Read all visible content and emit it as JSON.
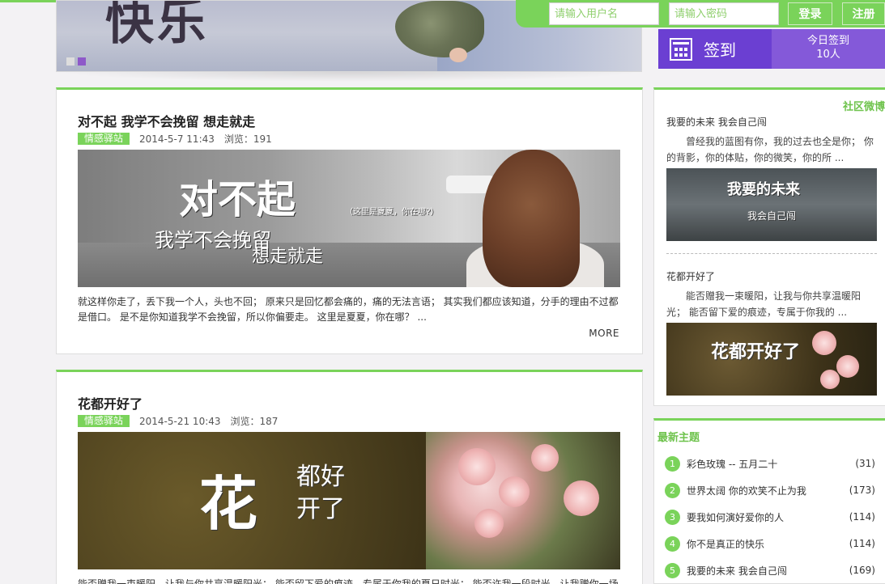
{
  "login": {
    "username_placeholder": "请输入用户名",
    "password_placeholder": "请输入密码",
    "login_label": "登录",
    "register_label": "注册"
  },
  "checkin": {
    "label": "签到",
    "today_label": "今日签到",
    "today_count": "10人"
  },
  "posts": [
    {
      "title": "对不起 我学不会挽留 想走就走",
      "tag": "情感驿站",
      "date": "2014-5-7 11:43",
      "views": "浏览：191",
      "excerpt": "就这样你走了，丢下我一个人，头也不回； 原来只是回忆都会痛的，痛的无法言语； 其实我们都应该知道，分手的理由不过都是借口。 是不是你知道我学不会挽留，所以你偏要走。 这里是夏夏，你在哪？ ...",
      "more": "MORE",
      "img_text_main": "对不起",
      "img_text_sub1": "我学不会挽留",
      "img_text_sub2": "想走就走",
      "img_text_note": "（这里是夏夏，你在哪?）"
    },
    {
      "title": "花都开好了",
      "tag": "情感驿站",
      "date": "2014-5-21 10:43",
      "views": "浏览：187",
      "excerpt": "能否赠我一束暖阳，让我与你共享温暖阳光； 能否留下爱的痕迹，专属于你我的夏日时光； 能否许我一段时光，让我赠你一场",
      "img_text_main": "花",
      "img_text_sub1": "都好",
      "img_text_sub2": "开了"
    }
  ],
  "sidebar": {
    "weibo": {
      "header": "社区微博",
      "items": [
        {
          "title": "我要的未来 我会自己闯",
          "text": "曾经我的蓝图有你，我的过去也全是你； 你的背影，你的体贴，你的微笑，你的所 ...",
          "img_text_main": "我要的未来",
          "img_text_sub": "我会自己闯"
        },
        {
          "title": "花都开好了",
          "text": "能否赠我一束暖阳，让我与你共享温暖阳光； 能否留下爱的痕迹，专属于你我的 ...",
          "img_text_main": "花都开好了"
        }
      ]
    },
    "latest": {
      "header": "最新主题",
      "items": [
        {
          "num": "1",
          "title": "彩色玫瑰 -- 五月二十",
          "count": "(31)"
        },
        {
          "num": "2",
          "title": "世界太阔 你的欢笑不止为我",
          "count": "(173)"
        },
        {
          "num": "3",
          "title": "要我如何演好爱你的人",
          "count": "(114)"
        },
        {
          "num": "4",
          "title": "你不是真正的快乐",
          "count": "(114)"
        },
        {
          "num": "5",
          "title": "我要的未来 我会自己闯",
          "count": "(169)"
        }
      ]
    }
  },
  "colors": {
    "accent": "#7ad35a",
    "purple": "#6b3fd2",
    "purple_light": "#8459d9"
  },
  "banner": {
    "text": "快乐",
    "slider_total": 2,
    "slider_active": 2
  }
}
